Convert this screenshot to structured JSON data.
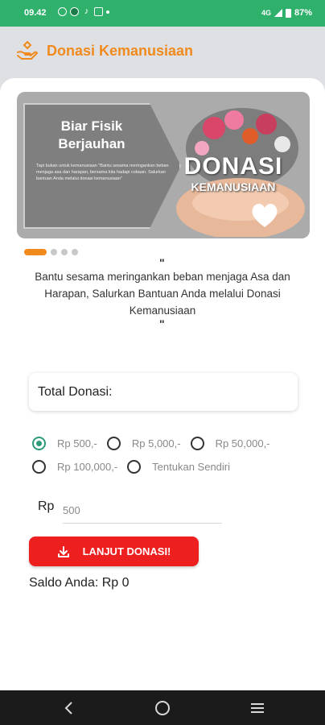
{
  "status_bar": {
    "time": "09.42",
    "network": "4G",
    "battery": "87%"
  },
  "header": {
    "title": "Donasi Kemanusiaan",
    "icon": "donation-hand-icon",
    "accent_color": "#f08a1c"
  },
  "banner": {
    "headline": "Biar Fisik Berjauhan",
    "small_text": "Tapi bukan untuk kemanusiaan \"Bantu sesama meringankan beban menjaga asa dan harapan, bersama kita hadapi cobaan. Salurkan bantuan Anda melalui donasi kemanusiaan\"",
    "big_title": "DONASI",
    "big_subtitle": "KEMANUSIAAN",
    "slide_count": 4,
    "active_slide": 1
  },
  "quote": {
    "open_mark": "\"",
    "text": "Bantu sesama meringankan beban menjaga Asa dan Harapan, Salurkan Bantuan Anda melalui Donasi Kemanusiaan",
    "close_mark": "\""
  },
  "donation": {
    "total_label": "Total Donasi:",
    "options": [
      {
        "label": "Rp 500,-",
        "checked": true
      },
      {
        "label": "Rp 5,000,-",
        "checked": false
      },
      {
        "label": "Rp 50,000,-",
        "checked": false
      },
      {
        "label": "Rp 100,000,-",
        "checked": false
      },
      {
        "label": "Tentukan Sendiri",
        "checked": false
      }
    ],
    "currency_label": "Rp",
    "amount_value": "500",
    "submit_label": "LANJUT DONASI!",
    "submit_color": "#ee1f1f",
    "balance_text": "Saldo Anda: Rp 0"
  },
  "nav": {
    "back": "back-icon",
    "home": "home-icon",
    "menu": "menu-icon"
  }
}
